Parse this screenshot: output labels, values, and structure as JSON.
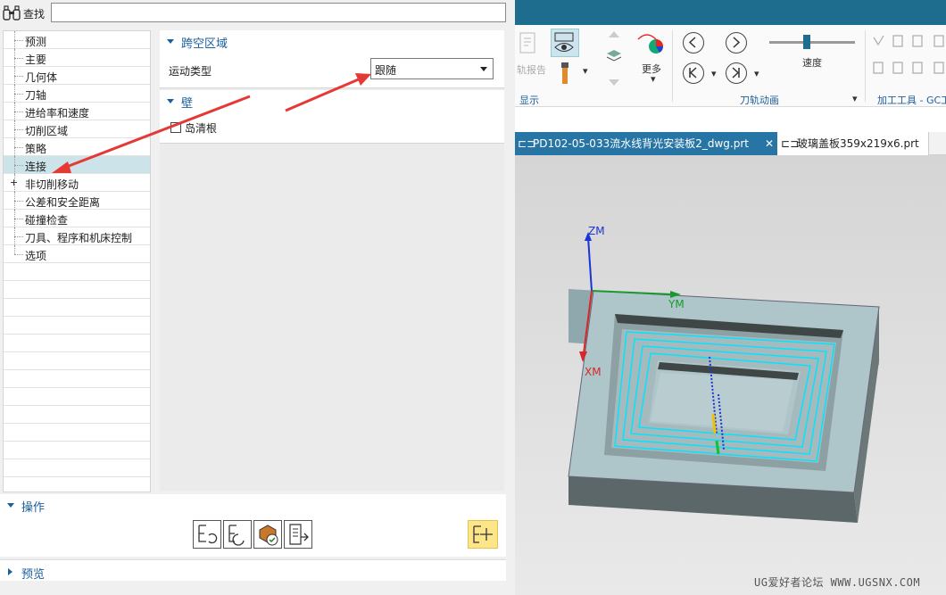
{
  "find": {
    "label": "查找",
    "value": ""
  },
  "tree": {
    "items": [
      {
        "label": "预测",
        "selected": false,
        "expandable": false
      },
      {
        "label": "主要",
        "selected": false,
        "expandable": false
      },
      {
        "label": "几何体",
        "selected": false,
        "expandable": false
      },
      {
        "label": "刀轴",
        "selected": false,
        "expandable": false
      },
      {
        "label": "进给率和速度",
        "selected": false,
        "expandable": false
      },
      {
        "label": "切削区域",
        "selected": false,
        "expandable": false
      },
      {
        "label": "策略",
        "selected": false,
        "expandable": false
      },
      {
        "label": "连接",
        "selected": true,
        "expandable": false
      },
      {
        "label": "非切削移动",
        "selected": false,
        "expandable": true
      },
      {
        "label": "公差和安全距离",
        "selected": false,
        "expandable": false
      },
      {
        "label": "碰撞检查",
        "selected": false,
        "expandable": false
      },
      {
        "label": "刀具、程序和机床控制",
        "selected": false,
        "expandable": false
      },
      {
        "label": "选项",
        "selected": false,
        "expandable": false
      }
    ]
  },
  "panel": {
    "cross_region": {
      "title": "跨空区域",
      "motion_type_label": "运动类型",
      "motion_type_value": "跟随"
    },
    "wall": {
      "title": "壁",
      "island_cleanup_label": "岛清根",
      "island_cleanup_checked": false
    }
  },
  "operations": {
    "title": "操作"
  },
  "preview": {
    "title": "预览"
  },
  "ribbon": {
    "report_label": "轨报告",
    "more_label": "更多",
    "display_label": "显示",
    "speed_label": "速度",
    "animation_label": "刀轨动画",
    "tools_label": "加工工具 - GC工"
  },
  "tabs": [
    {
      "label": "PD102-05-033流水线背光安装板2_dwg.prt",
      "active": true
    },
    {
      "label": "玻璃盖板359x219x6.prt",
      "active": false
    }
  ],
  "axes": {
    "z": "ZM",
    "y": "YM",
    "x": "XM"
  },
  "watermark": "UG爱好者论坛 WWW.UGSNX.COM",
  "colors": {
    "accent": "#1c5fa0",
    "selected_row": "#cde3ea",
    "title_bar": "#1f6d8e",
    "active_tab": "#2675a4",
    "toolpath": "#00e5ff",
    "arrow": "#e53935"
  }
}
